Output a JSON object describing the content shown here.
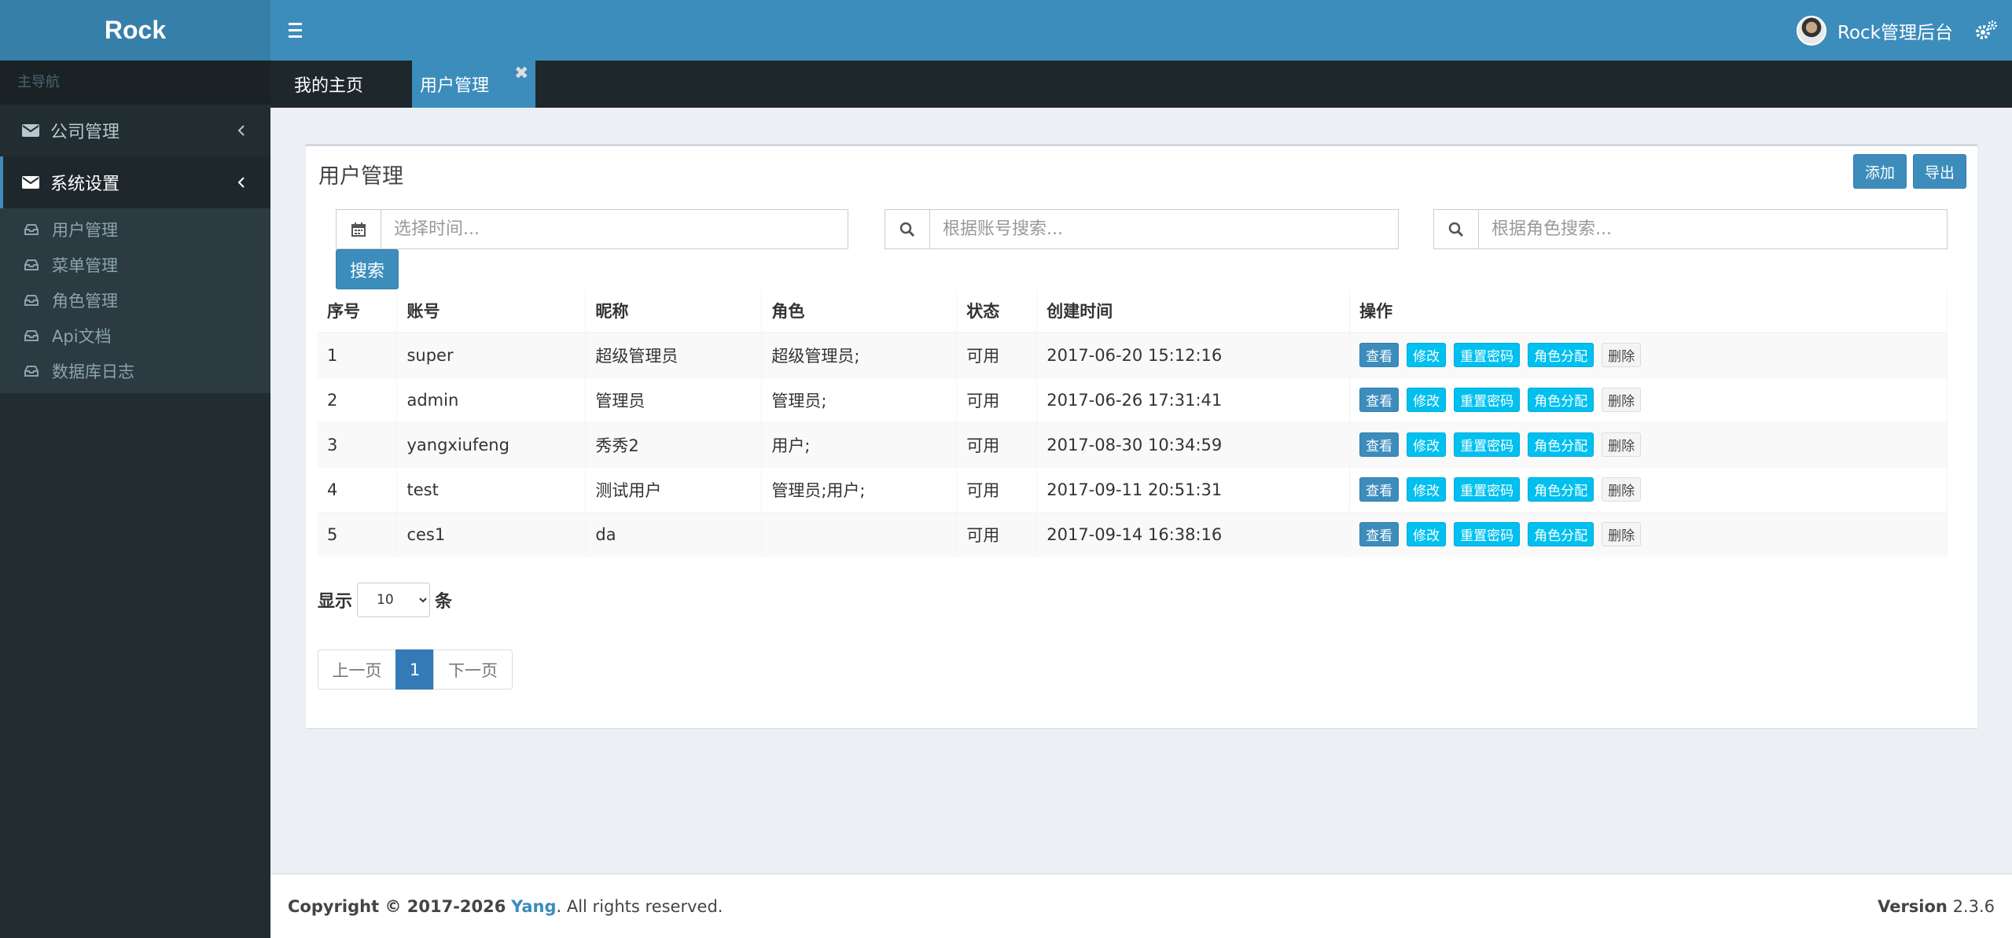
{
  "header": {
    "logo": "Rock",
    "user_name": "Rock管理后台"
  },
  "sidebar": {
    "section_title": "主导航",
    "items": [
      {
        "label": "公司管理"
      },
      {
        "label": "系统设置"
      }
    ],
    "submenu": [
      {
        "label": "用户管理"
      },
      {
        "label": "菜单管理"
      },
      {
        "label": "角色管理"
      },
      {
        "label": "Api文档"
      },
      {
        "label": "数据库日志"
      }
    ]
  },
  "tabs": {
    "home": "我的主页",
    "users": "用户管理",
    "close_glyph": "✖"
  },
  "page": {
    "title": "用户管理",
    "add_label": "添加",
    "export_label": "导出",
    "search_label": "搜索"
  },
  "filters": {
    "time_placeholder": "选择时间...",
    "account_placeholder": "根据账号搜索...",
    "role_placeholder": "根据角色搜索..."
  },
  "table": {
    "headers": [
      "序号",
      "账号",
      "昵称",
      "角色",
      "状态",
      "创建时间",
      "操作"
    ],
    "rows": [
      [
        "1",
        "super",
        "超级管理员",
        "超级管理员;",
        "可用",
        "2017-06-20 15:12:16"
      ],
      [
        "2",
        "admin",
        "管理员",
        "管理员;",
        "可用",
        "2017-06-26 17:31:41"
      ],
      [
        "3",
        "yangxiufeng",
        "秀秀2",
        "用户;",
        "可用",
        "2017-08-30 10:34:59"
      ],
      [
        "4",
        "test",
        "测试用户",
        "管理员;用户;",
        "可用",
        "2017-09-11 20:51:31"
      ],
      [
        "5",
        "ces1",
        "da",
        "",
        "可用",
        "2017-09-14 16:38:16"
      ]
    ],
    "actions": {
      "view": "查看",
      "edit": "修改",
      "reset": "重置密码",
      "assign": "角色分配",
      "delete": "删除"
    }
  },
  "pagination": {
    "show_label": "显示",
    "page_size": "10",
    "unit_label": "条",
    "prev": "上一页",
    "current": "1",
    "next": "下一页"
  },
  "footer": {
    "copyright": "Copyright © 2017-2026",
    "brand": "Yang",
    "rights": ". All rights reserved.",
    "version_label": "Version",
    "version": "2.3.6"
  },
  "colors": {
    "header": "#3c8dbc",
    "logo_bg": "#367fa9",
    "sidebar": "#222d32",
    "primary_button": "#3c8dbc",
    "info_button": "#00c0ef",
    "page_active": "#337ab7"
  }
}
